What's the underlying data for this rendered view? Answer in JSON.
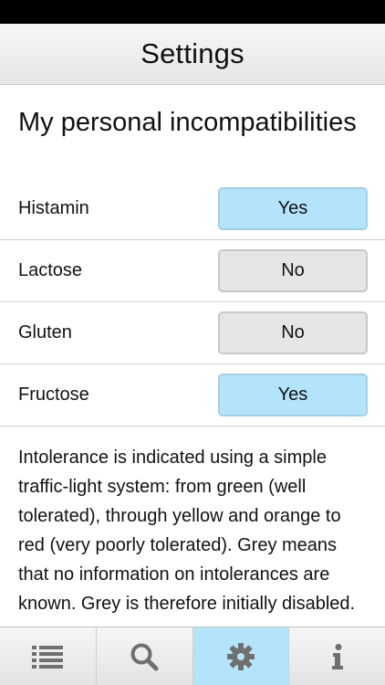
{
  "nav": {
    "title": "Settings"
  },
  "section": {
    "heading": "My personal incompatibilities"
  },
  "rows": [
    {
      "label": "Histamin",
      "value": "Yes",
      "on": true
    },
    {
      "label": "Lactose",
      "value": "No",
      "on": false
    },
    {
      "label": "Gluten",
      "value": "No",
      "on": false
    },
    {
      "label": "Fructose",
      "value": "Yes",
      "on": true
    }
  ],
  "info": {
    "text": "Intolerance is indicated using a simple traffic-light system: from green (well tolerated), through yellow and orange to red (very poorly tolerated). Grey means that no information on intolerances are known. Grey is therefore initially disabled."
  },
  "tabs": [
    {
      "icon": "list-icon",
      "active": false
    },
    {
      "icon": "search-icon",
      "active": false
    },
    {
      "icon": "gear-icon",
      "active": true
    },
    {
      "icon": "info-icon",
      "active": false
    }
  ],
  "colors": {
    "active_blue": "#b4e4fb",
    "inactive_gray": "#e6e6e6",
    "icon_gray": "#6f6f6f"
  }
}
